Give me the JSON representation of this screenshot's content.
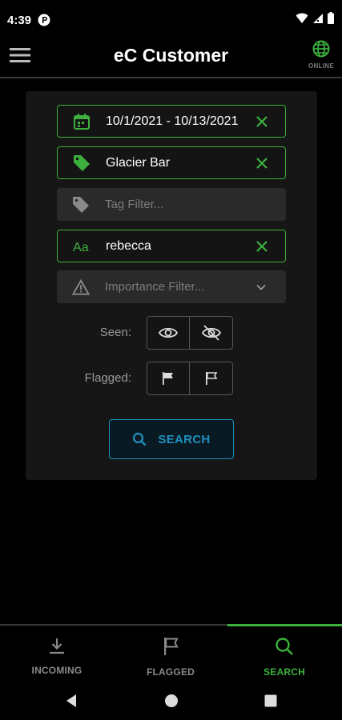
{
  "status": {
    "time": "4:39"
  },
  "app": {
    "title": "eC Customer",
    "online_label": "ONLINE"
  },
  "filters": {
    "date_range": "10/1/2021 - 10/13/2021",
    "location": "Glacier Bar",
    "tag_placeholder": "Tag Filter...",
    "text_query": "rebecca",
    "importance_placeholder": "Importance Filter..."
  },
  "toggles": {
    "seen_label": "Seen:",
    "flagged_label": "Flagged:"
  },
  "search": {
    "label": "SEARCH"
  },
  "nav": {
    "items": [
      {
        "label": "INCOMING",
        "icon": "download-icon",
        "active": false
      },
      {
        "label": "FLAGGED",
        "icon": "flag-icon",
        "active": false
      },
      {
        "label": "SEARCH",
        "icon": "search-icon",
        "active": true
      }
    ]
  },
  "colors": {
    "accent_green": "#3cb03c",
    "accent_blue": "#1e90c0",
    "background": "#000000",
    "panel": "#161616"
  }
}
